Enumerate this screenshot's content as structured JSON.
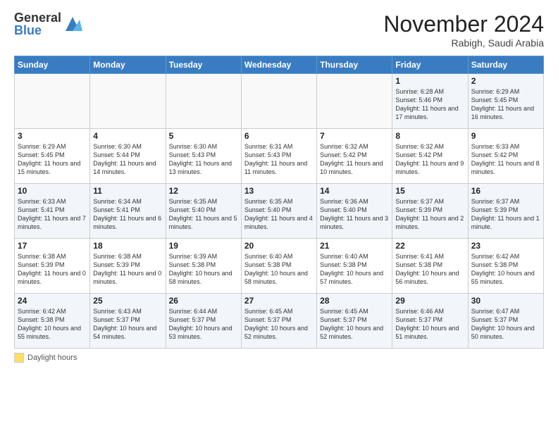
{
  "logo": {
    "general": "General",
    "blue": "Blue"
  },
  "header": {
    "month": "November 2024",
    "location": "Rabigh, Saudi Arabia"
  },
  "weekdays": [
    "Sunday",
    "Monday",
    "Tuesday",
    "Wednesday",
    "Thursday",
    "Friday",
    "Saturday"
  ],
  "legend": {
    "label": "Daylight hours"
  },
  "weeks": [
    [
      {
        "day": "",
        "info": ""
      },
      {
        "day": "",
        "info": ""
      },
      {
        "day": "",
        "info": ""
      },
      {
        "day": "",
        "info": ""
      },
      {
        "day": "",
        "info": ""
      },
      {
        "day": "1",
        "info": "Sunrise: 6:28 AM\nSunset: 5:46 PM\nDaylight: 11 hours and 17 minutes."
      },
      {
        "day": "2",
        "info": "Sunrise: 6:29 AM\nSunset: 5:45 PM\nDaylight: 11 hours and 16 minutes."
      }
    ],
    [
      {
        "day": "3",
        "info": "Sunrise: 6:29 AM\nSunset: 5:45 PM\nDaylight: 11 hours and 15 minutes."
      },
      {
        "day": "4",
        "info": "Sunrise: 6:30 AM\nSunset: 5:44 PM\nDaylight: 11 hours and 14 minutes."
      },
      {
        "day": "5",
        "info": "Sunrise: 6:30 AM\nSunset: 5:43 PM\nDaylight: 11 hours and 13 minutes."
      },
      {
        "day": "6",
        "info": "Sunrise: 6:31 AM\nSunset: 5:43 PM\nDaylight: 11 hours and 11 minutes."
      },
      {
        "day": "7",
        "info": "Sunrise: 6:32 AM\nSunset: 5:42 PM\nDaylight: 11 hours and 10 minutes."
      },
      {
        "day": "8",
        "info": "Sunrise: 6:32 AM\nSunset: 5:42 PM\nDaylight: 11 hours and 9 minutes."
      },
      {
        "day": "9",
        "info": "Sunrise: 6:33 AM\nSunset: 5:42 PM\nDaylight: 11 hours and 8 minutes."
      }
    ],
    [
      {
        "day": "10",
        "info": "Sunrise: 6:33 AM\nSunset: 5:41 PM\nDaylight: 11 hours and 7 minutes."
      },
      {
        "day": "11",
        "info": "Sunrise: 6:34 AM\nSunset: 5:41 PM\nDaylight: 11 hours and 6 minutes."
      },
      {
        "day": "12",
        "info": "Sunrise: 6:35 AM\nSunset: 5:40 PM\nDaylight: 11 hours and 5 minutes."
      },
      {
        "day": "13",
        "info": "Sunrise: 6:35 AM\nSunset: 5:40 PM\nDaylight: 11 hours and 4 minutes."
      },
      {
        "day": "14",
        "info": "Sunrise: 6:36 AM\nSunset: 5:40 PM\nDaylight: 11 hours and 3 minutes."
      },
      {
        "day": "15",
        "info": "Sunrise: 6:37 AM\nSunset: 5:39 PM\nDaylight: 11 hours and 2 minutes."
      },
      {
        "day": "16",
        "info": "Sunrise: 6:37 AM\nSunset: 5:39 PM\nDaylight: 11 hours and 1 minute."
      }
    ],
    [
      {
        "day": "17",
        "info": "Sunrise: 6:38 AM\nSunset: 5:39 PM\nDaylight: 11 hours and 0 minutes."
      },
      {
        "day": "18",
        "info": "Sunrise: 6:38 AM\nSunset: 5:39 PM\nDaylight: 11 hours and 0 minutes."
      },
      {
        "day": "19",
        "info": "Sunrise: 6:39 AM\nSunset: 5:38 PM\nDaylight: 10 hours and 58 minutes."
      },
      {
        "day": "20",
        "info": "Sunrise: 6:40 AM\nSunset: 5:38 PM\nDaylight: 10 hours and 58 minutes."
      },
      {
        "day": "21",
        "info": "Sunrise: 6:40 AM\nSunset: 5:38 PM\nDaylight: 10 hours and 57 minutes."
      },
      {
        "day": "22",
        "info": "Sunrise: 6:41 AM\nSunset: 5:38 PM\nDaylight: 10 hours and 56 minutes."
      },
      {
        "day": "23",
        "info": "Sunrise: 6:42 AM\nSunset: 5:38 PM\nDaylight: 10 hours and 55 minutes."
      }
    ],
    [
      {
        "day": "24",
        "info": "Sunrise: 6:42 AM\nSunset: 5:38 PM\nDaylight: 10 hours and 55 minutes."
      },
      {
        "day": "25",
        "info": "Sunrise: 6:43 AM\nSunset: 5:37 PM\nDaylight: 10 hours and 54 minutes."
      },
      {
        "day": "26",
        "info": "Sunrise: 6:44 AM\nSunset: 5:37 PM\nDaylight: 10 hours and 53 minutes."
      },
      {
        "day": "27",
        "info": "Sunrise: 6:45 AM\nSunset: 5:37 PM\nDaylight: 10 hours and 52 minutes."
      },
      {
        "day": "28",
        "info": "Sunrise: 6:45 AM\nSunset: 5:37 PM\nDaylight: 10 hours and 52 minutes."
      },
      {
        "day": "29",
        "info": "Sunrise: 6:46 AM\nSunset: 5:37 PM\nDaylight: 10 hours and 51 minutes."
      },
      {
        "day": "30",
        "info": "Sunrise: 6:47 AM\nSunset: 5:37 PM\nDaylight: 10 hours and 50 minutes."
      }
    ]
  ]
}
